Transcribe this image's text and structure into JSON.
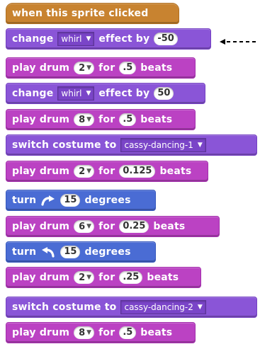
{
  "colors": {
    "events": "#c88330",
    "looks": "#8a55d7",
    "sound": "#bb42c3",
    "motion": "#4a6cd4"
  },
  "script": {
    "hat": {
      "label": "when this sprite clicked"
    },
    "b1": {
      "w1": "change",
      "effect": "whirl",
      "w2": "effect by",
      "value": "-50"
    },
    "b2": {
      "w1": "play drum",
      "drum": "2",
      "w2": "for",
      "beats": ".5",
      "w3": "beats"
    },
    "b3": {
      "w1": "change",
      "effect": "whirl",
      "w2": "effect by",
      "value": "50"
    },
    "b4": {
      "w1": "play drum",
      "drum": "8",
      "w2": "for",
      "beats": ".5",
      "w3": "beats"
    },
    "b5": {
      "w1": "switch costume to",
      "costume": "cassy-dancing-1"
    },
    "b6": {
      "w1": "play drum",
      "drum": "2",
      "w2": "for",
      "beats": "0.125",
      "w3": "beats"
    },
    "b7": {
      "w1": "turn",
      "icon": "rotate-clockwise-icon",
      "value": "15",
      "w2": "degrees"
    },
    "b8": {
      "w1": "play drum",
      "drum": "6",
      "w2": "for",
      "beats": "0.25",
      "w3": "beats"
    },
    "b9": {
      "w1": "turn",
      "icon": "rotate-counterclockwise-icon",
      "value": "15",
      "w2": "degrees"
    },
    "b10": {
      "w1": "play drum",
      "drum": "2",
      "w2": "for",
      "beats": ".25",
      "w3": "beats"
    },
    "b11": {
      "w1": "switch costume to",
      "costume": "cassy-dancing-2"
    },
    "b12": {
      "w1": "play drum",
      "drum": "8",
      "w2": "for",
      "beats": ".5",
      "w3": "beats"
    }
  },
  "annotation": {
    "icon": "dashed-arrow-icon"
  }
}
